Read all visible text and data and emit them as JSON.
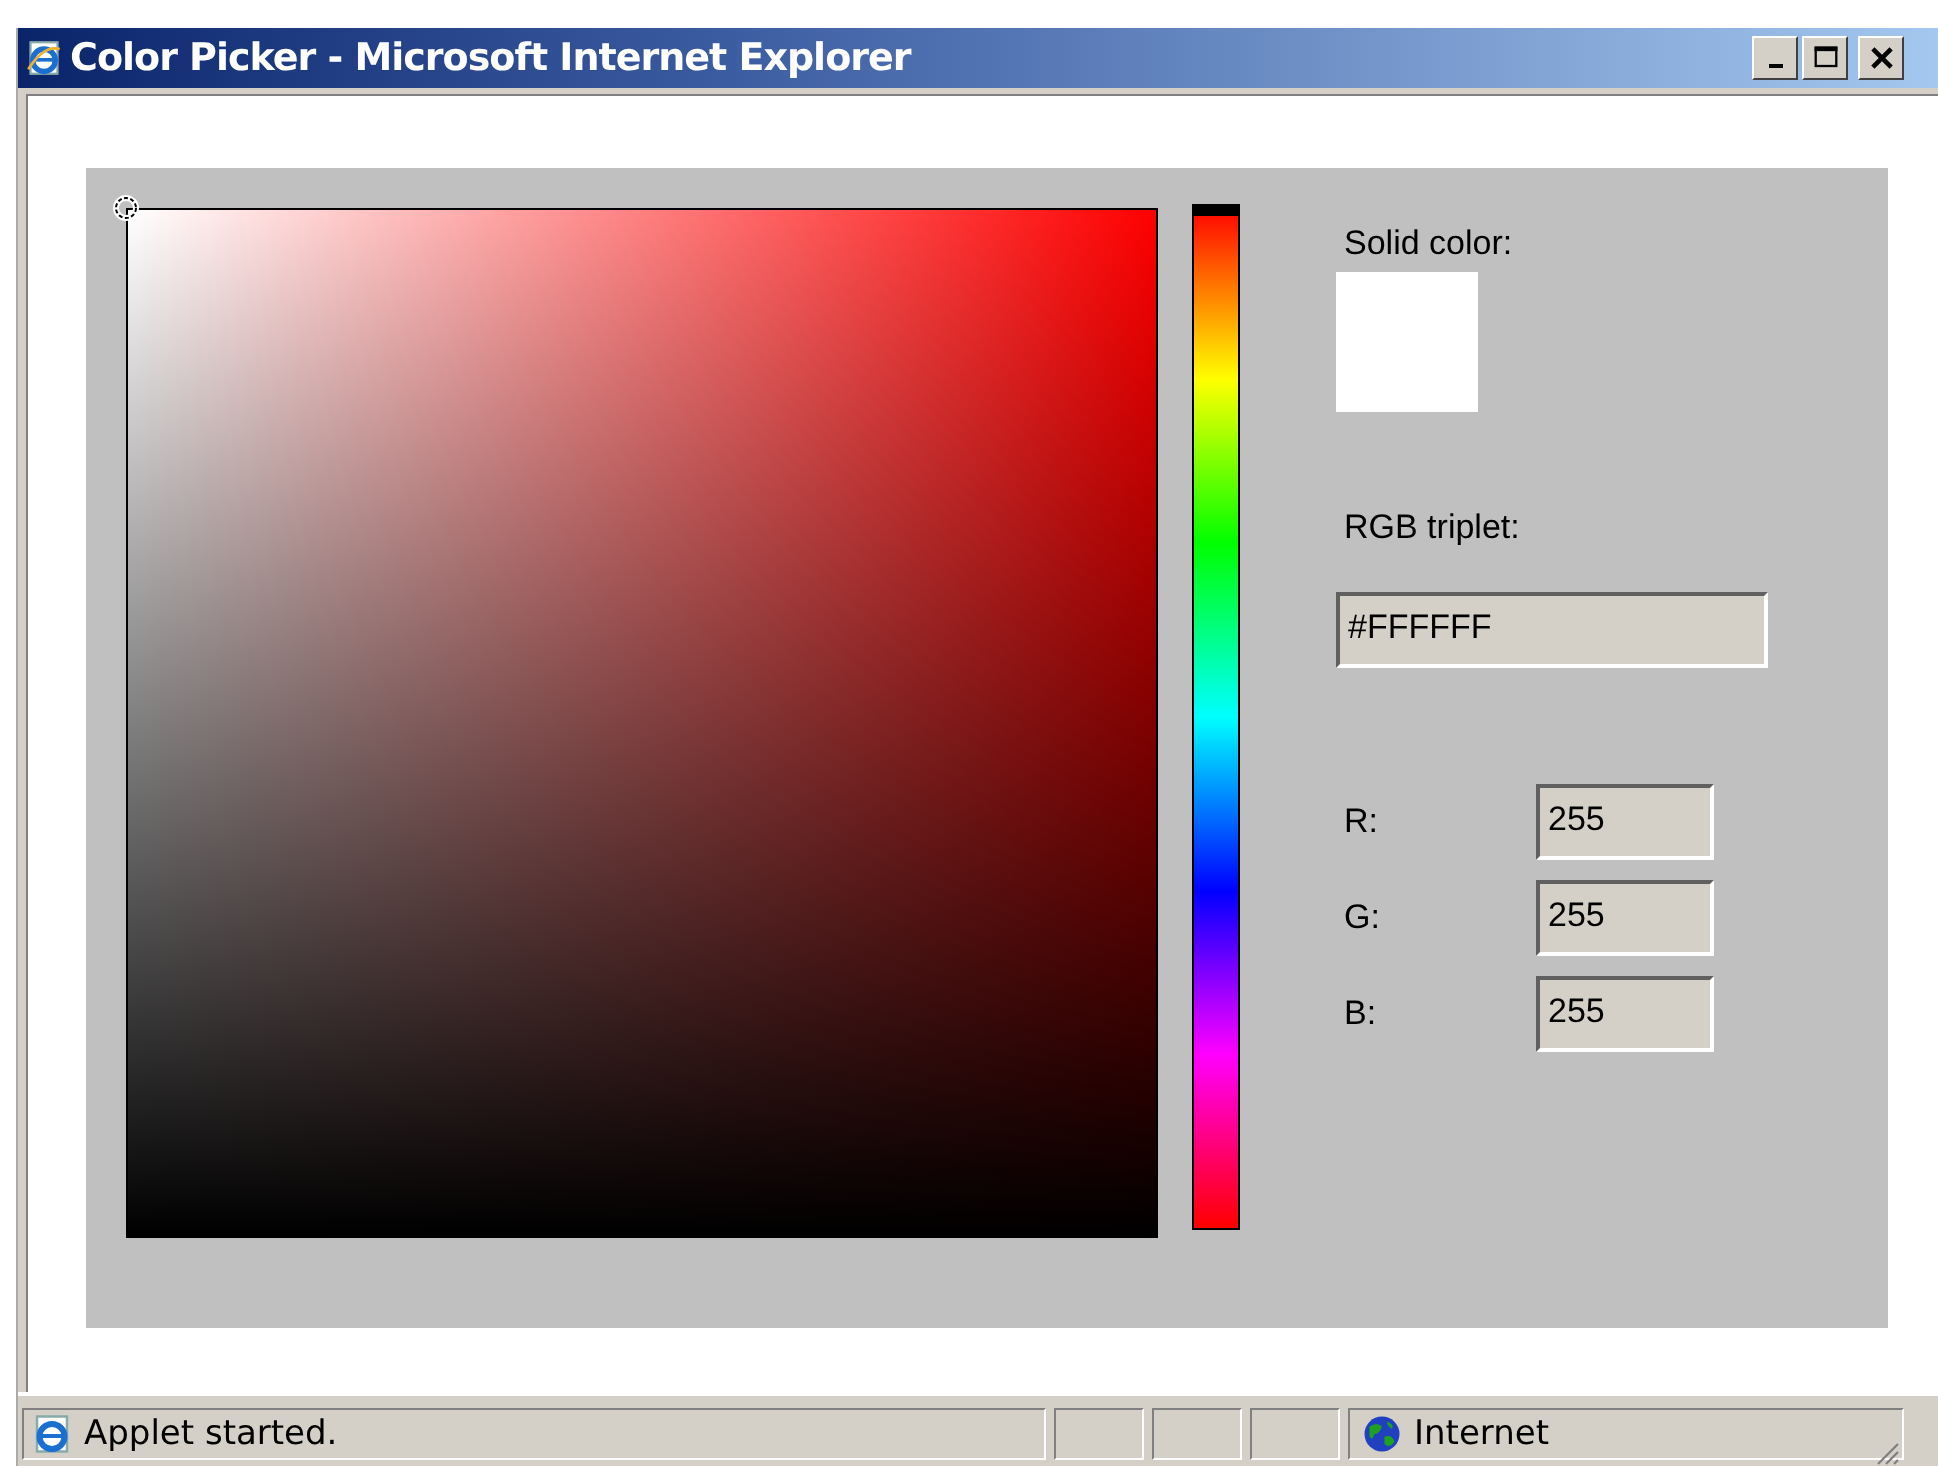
{
  "window": {
    "title": "Color Picker - Microsoft Internet Explorer"
  },
  "hue_slider": {
    "level": 0
  },
  "panel": {
    "solid_label": "Solid color:",
    "rgb_label": "RGB triplet:",
    "rgb_value": "#FFFFFF",
    "channels": [
      {
        "label": "R:",
        "value": "255"
      },
      {
        "label": "G:",
        "value": "255"
      },
      {
        "label": "B:",
        "value": "255"
      }
    ]
  },
  "status_bar": {
    "message": "Applet started.",
    "zone": "Internet"
  }
}
